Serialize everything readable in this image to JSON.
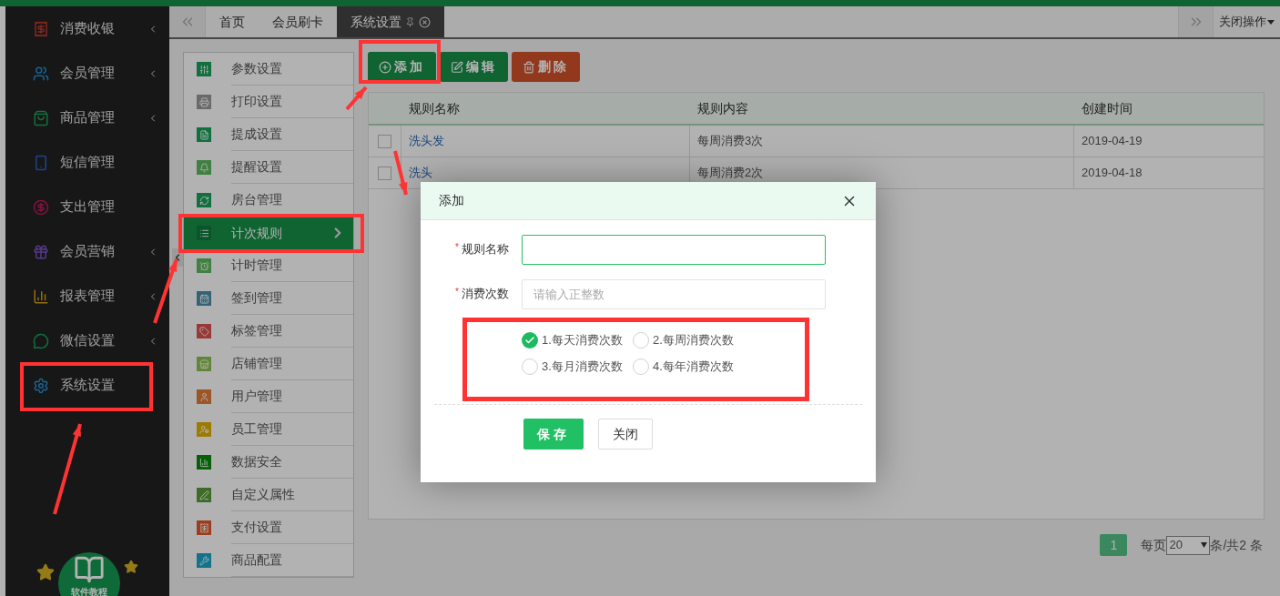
{
  "sidebar": {
    "items": [
      {
        "label": "消费收银",
        "expandable": true
      },
      {
        "label": "会员管理",
        "expandable": true
      },
      {
        "label": "商品管理",
        "expandable": true
      },
      {
        "label": "短信管理",
        "expandable": false
      },
      {
        "label": "支出管理",
        "expandable": false
      },
      {
        "label": "会员营销",
        "expandable": true
      },
      {
        "label": "报表管理",
        "expandable": true
      },
      {
        "label": "微信设置",
        "expandable": true
      },
      {
        "label": "系统设置",
        "expandable": false
      }
    ],
    "tutorial_badge": "软件教程"
  },
  "tabs": [
    {
      "label": "首页",
      "selected": false
    },
    {
      "label": "会员刷卡",
      "selected": false
    },
    {
      "label": "系统设置",
      "selected": true
    }
  ],
  "close_menu": "关闭操作",
  "settings_menu": [
    {
      "label": "参数设置",
      "selected": false
    },
    {
      "label": "打印设置",
      "selected": false
    },
    {
      "label": "提成设置",
      "selected": false
    },
    {
      "label": "提醒设置",
      "selected": false
    },
    {
      "label": "房台管理",
      "selected": false
    },
    {
      "label": "计次规则",
      "selected": true
    },
    {
      "label": "计时管理",
      "selected": false
    },
    {
      "label": "签到管理",
      "selected": false
    },
    {
      "label": "标签管理",
      "selected": false
    },
    {
      "label": "店铺管理",
      "selected": false
    },
    {
      "label": "用户管理",
      "selected": false
    },
    {
      "label": "员工管理",
      "selected": false
    },
    {
      "label": "数据安全",
      "selected": false
    },
    {
      "label": "自定义属性",
      "selected": false
    },
    {
      "label": "支付设置",
      "selected": false
    },
    {
      "label": "商品配置",
      "selected": false
    }
  ],
  "toolbar": [
    {
      "label": "添加",
      "kind": "add"
    },
    {
      "label": "编辑",
      "kind": "edit"
    },
    {
      "label": "删除",
      "kind": "delete"
    }
  ],
  "table": {
    "columns": [
      "规则名称",
      "规则内容",
      "创建时间"
    ],
    "rows": [
      {
        "checked": false,
        "name": "洗头发",
        "content": "每周消费3次",
        "created": "2019-04-19"
      },
      {
        "checked": false,
        "name": "洗头",
        "content": "每周消费2次",
        "created": "2019-04-18"
      }
    ]
  },
  "pagination": {
    "pages": [
      {
        "label": "1",
        "selected": true
      }
    ],
    "per_page_label": "每页",
    "per_page": "20",
    "summary": "条/共2 条"
  },
  "dialog": {
    "title": "添加",
    "fields": [
      {
        "required_mark": "*",
        "label": "规则名称",
        "focused": true
      },
      {
        "required_mark": "*",
        "label": "消费次数",
        "placeholder": "请输入正整数",
        "focused": false
      }
    ],
    "options": [
      {
        "label": "1.每天消费次数",
        "selected": true
      },
      {
        "label": "2.每周消费次数",
        "selected": false
      },
      {
        "label": "3.每月消费次数",
        "selected": false
      },
      {
        "label": "4.每年消费次数",
        "selected": false
      }
    ],
    "buttons": [
      {
        "label": "保存",
        "kind": "primary"
      },
      {
        "label": "关闭",
        "kind": "default"
      }
    ]
  }
}
